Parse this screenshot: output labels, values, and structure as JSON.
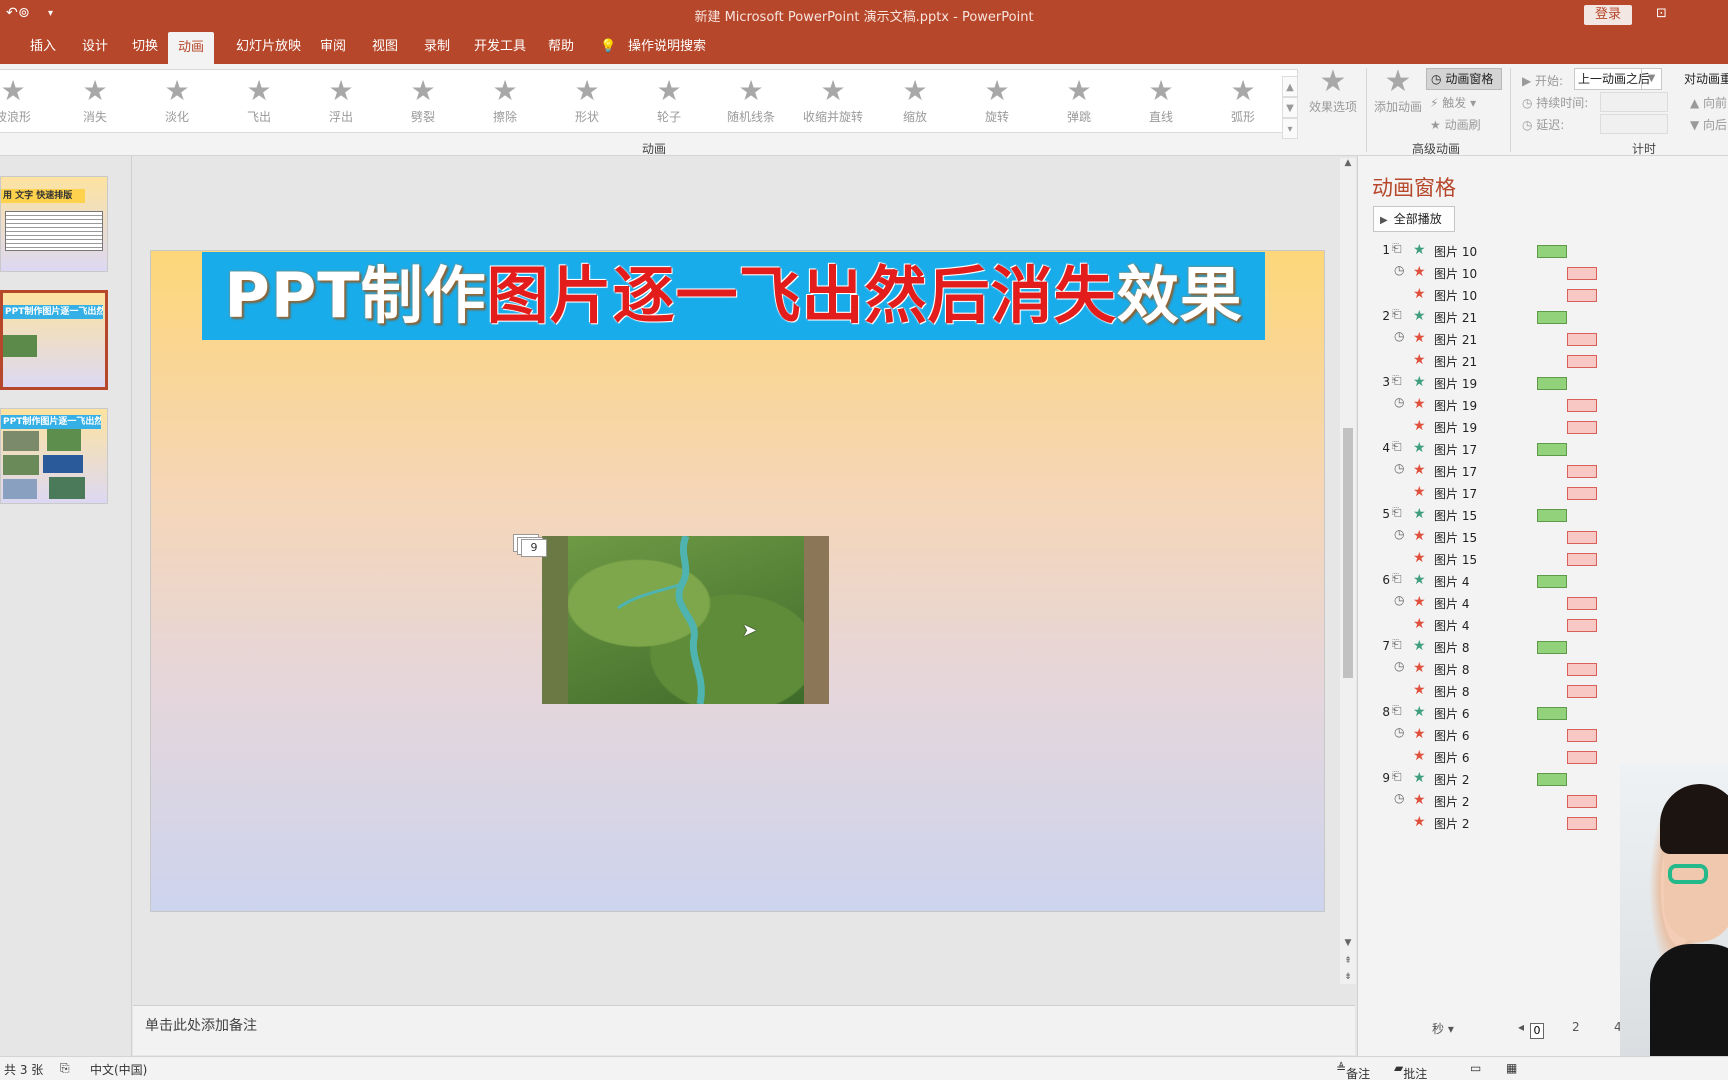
{
  "window": {
    "title": "新建 Microsoft PowerPoint 演示文稿.pptx  -  PowerPoint",
    "login_label": "登录"
  },
  "tabs": [
    {
      "label": "插入"
    },
    {
      "label": "设计"
    },
    {
      "label": "切换"
    },
    {
      "label": "动画",
      "active": true
    },
    {
      "label": "幻灯片放映"
    },
    {
      "label": "审阅"
    },
    {
      "label": "视图"
    },
    {
      "label": "录制"
    },
    {
      "label": "开发工具"
    },
    {
      "label": "帮助"
    },
    {
      "label": "操作说明搜索"
    }
  ],
  "ribbon": {
    "gallery_items": [
      "波浪形",
      "消失",
      "淡化",
      "飞出",
      "浮出",
      "劈裂",
      "擦除",
      "形状",
      "轮子",
      "随机线条",
      "收缩并旋转",
      "缩放",
      "旋转",
      "弹跳",
      "直线",
      "弧形"
    ],
    "effect_options_label": "效果选项",
    "group_animation_label": "动画",
    "add_animation_label": "添加动画",
    "animation_pane_label": "动画窗格",
    "trigger_label": "触发",
    "painter_label": "动画刷",
    "group_advanced_label": "高级动画",
    "start_label": "开始:",
    "start_value": "上一动画之后",
    "duration_label": "持续时间:",
    "delay_label": "延迟:",
    "reorder_label": "对动画重",
    "move_earlier_label": "向前",
    "move_later_label": "向后",
    "group_timing_label": "计时"
  },
  "thumbnails": {
    "slide1_title": "用 文字 快速排版",
    "slide2_title": "PPT制作图片逐一飞出然后消失效果",
    "slide3_title": "PPT制作图片逐一飞出然后消失效果"
  },
  "slide": {
    "title_part1": "PPT制作",
    "title_part2": "图片逐一飞出然后消失",
    "title_part3": "效果",
    "badge_number": "9"
  },
  "notes_placeholder": "单击此处添加备注",
  "pane": {
    "title": "动画窗格",
    "play_all_label": "全部播放",
    "items": [
      {
        "num": "1",
        "name": "图片 10",
        "type": "enter"
      },
      {
        "num": "",
        "name": "图片 10",
        "type": "exit",
        "clock": true
      },
      {
        "num": "",
        "name": "图片 10",
        "type": "exit"
      },
      {
        "num": "2",
        "name": "图片 21",
        "type": "enter"
      },
      {
        "num": "",
        "name": "图片 21",
        "type": "exit",
        "clock": true
      },
      {
        "num": "",
        "name": "图片 21",
        "type": "exit"
      },
      {
        "num": "3",
        "name": "图片 19",
        "type": "enter"
      },
      {
        "num": "",
        "name": "图片 19",
        "type": "exit",
        "clock": true
      },
      {
        "num": "",
        "name": "图片 19",
        "type": "exit"
      },
      {
        "num": "4",
        "name": "图片 17",
        "type": "enter"
      },
      {
        "num": "",
        "name": "图片 17",
        "type": "exit",
        "clock": true
      },
      {
        "num": "",
        "name": "图片 17",
        "type": "exit"
      },
      {
        "num": "5",
        "name": "图片 15",
        "type": "enter"
      },
      {
        "num": "",
        "name": "图片 15",
        "type": "exit",
        "clock": true
      },
      {
        "num": "",
        "name": "图片 15",
        "type": "exit"
      },
      {
        "num": "6",
        "name": "图片 4",
        "type": "enter"
      },
      {
        "num": "",
        "name": "图片 4",
        "type": "exit",
        "clock": true
      },
      {
        "num": "",
        "name": "图片 4",
        "type": "exit"
      },
      {
        "num": "7",
        "name": "图片 8",
        "type": "enter"
      },
      {
        "num": "",
        "name": "图片 8",
        "type": "exit",
        "clock": true
      },
      {
        "num": "",
        "name": "图片 8",
        "type": "exit"
      },
      {
        "num": "8",
        "name": "图片 6",
        "type": "enter"
      },
      {
        "num": "",
        "name": "图片 6",
        "type": "exit",
        "clock": true
      },
      {
        "num": "",
        "name": "图片 6",
        "type": "exit"
      },
      {
        "num": "9",
        "name": "图片 2",
        "type": "enter"
      },
      {
        "num": "",
        "name": "图片 2",
        "type": "exit",
        "clock": true
      },
      {
        "num": "",
        "name": "图片 2",
        "type": "exit"
      }
    ],
    "seconds_label": "秒",
    "timeline_ticks": [
      "0",
      "2",
      "4"
    ]
  },
  "colors": {
    "brand": "#b7472a",
    "enter_star": "#3f9f7f",
    "exit_star": "#e0503c",
    "enter_bar": "#92d27a",
    "exit_bar": "#f8c8c4"
  },
  "status": {
    "slide_count": "共 3 张",
    "language": "中文(中国)",
    "notes_label": "备注",
    "comments_label": "批注"
  }
}
